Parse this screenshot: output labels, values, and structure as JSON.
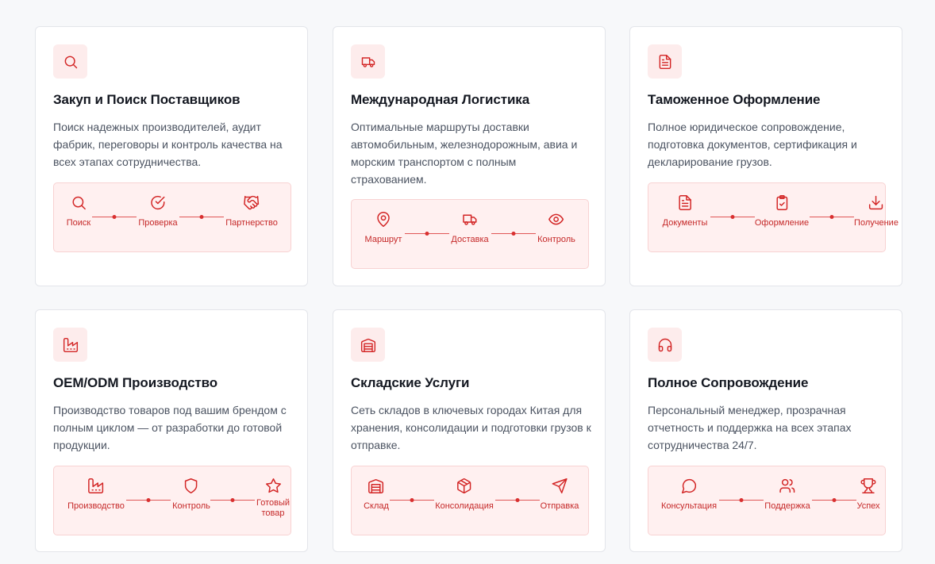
{
  "colors": {
    "accent": "#d32626",
    "badge_bg": "#fdecec",
    "flow_bg": "#fff0f0"
  },
  "cards": [
    {
      "icon": "search-icon",
      "title": "Закуп и Поиск Поставщиков",
      "description": "Поиск надежных производителей, аудит фабрик, переговоры и контроль качества на всех этапах сотрудничества.",
      "steps": [
        {
          "icon": "search-icon",
          "label": "Поиск"
        },
        {
          "icon": "check-circle-icon",
          "label": "Проверка"
        },
        {
          "icon": "handshake-icon",
          "label": "Партнерство"
        }
      ]
    },
    {
      "icon": "truck-icon",
      "title": "Международная Логистика",
      "description": "Оптимальные маршруты доставки автомобильным, железнодорожным, авиа и морским транспортом с полным страхованием.",
      "steps": [
        {
          "icon": "map-pin-icon",
          "label": "Маршрут"
        },
        {
          "icon": "truck-icon",
          "label": "Доставка"
        },
        {
          "icon": "eye-icon",
          "label": "Контроль"
        }
      ]
    },
    {
      "icon": "document-icon",
      "title": "Таможенное Оформление",
      "description": "Полное юридическое сопровождение, подготовка документов, сертификация и декларирование грузов.",
      "steps": [
        {
          "icon": "document-icon",
          "label": "Документы"
        },
        {
          "icon": "clipboard-check-icon",
          "label": "Оформление"
        },
        {
          "icon": "download-icon",
          "label": "Получение"
        }
      ]
    },
    {
      "icon": "factory-icon",
      "title": "OEM/ODM Производство",
      "description": "Производство товаров под вашим брендом с полным циклом — от разработки до готовой продукции.",
      "steps": [
        {
          "icon": "factory-icon",
          "label": "Производство"
        },
        {
          "icon": "shield-icon",
          "label": "Контроль"
        },
        {
          "icon": "star-icon",
          "label": "Готовый товар"
        }
      ]
    },
    {
      "icon": "warehouse-icon",
      "title": "Складские Услуги",
      "description": "Сеть складов в ключевых городах Китая для хранения, консолидации и подготовки грузов к отправке.",
      "steps": [
        {
          "icon": "warehouse-icon",
          "label": "Склад"
        },
        {
          "icon": "package-icon",
          "label": "Консолидация"
        },
        {
          "icon": "send-icon",
          "label": "Отправка"
        }
      ]
    },
    {
      "icon": "headphones-icon",
      "title": "Полное Сопровождение",
      "description": "Персональный менеджер, прозрачная отчетность и поддержка на всех этапах сотрудничества 24/7.",
      "steps": [
        {
          "icon": "message-circle-icon",
          "label": "Консультация"
        },
        {
          "icon": "users-icon",
          "label": "Поддержка"
        },
        {
          "icon": "trophy-icon",
          "label": "Успех"
        }
      ]
    }
  ]
}
